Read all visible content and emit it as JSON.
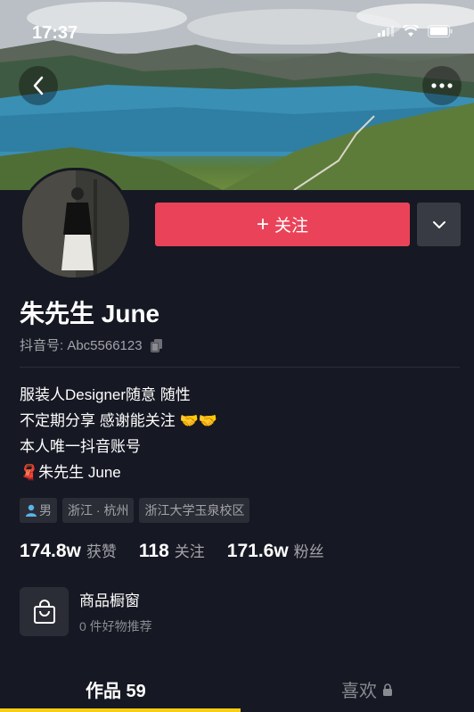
{
  "status_bar": {
    "time": "17:37"
  },
  "header": {
    "back_icon": "chevron-left-icon",
    "more_icon": "ellipsis-icon"
  },
  "profile": {
    "name": "朱先生 June",
    "douyin_id": "抖音号: Abc5566123",
    "follow_label": "关注",
    "bio_lines": [
      "服装人Designer随意 随性",
      "不定期分享 感谢能关注 🤝🤝",
      "本人唯一抖音账号",
      "🧣朱先生 June"
    ],
    "tags": [
      "男",
      "浙江 · 杭州",
      "浙江大学玉泉校区"
    ]
  },
  "stats": [
    {
      "value": "174.8w",
      "label": "获赞"
    },
    {
      "value": "118",
      "label": "关注"
    },
    {
      "value": "171.6w",
      "label": "粉丝"
    }
  ],
  "shop": {
    "title": "商品橱窗",
    "subtitle": "0 件好物推荐"
  },
  "tabs": [
    {
      "label": "作品 59"
    },
    {
      "label": "喜欢"
    }
  ],
  "colors": {
    "background": "#161823",
    "follow": "#ea4359",
    "tab_indicator": "#face15"
  }
}
